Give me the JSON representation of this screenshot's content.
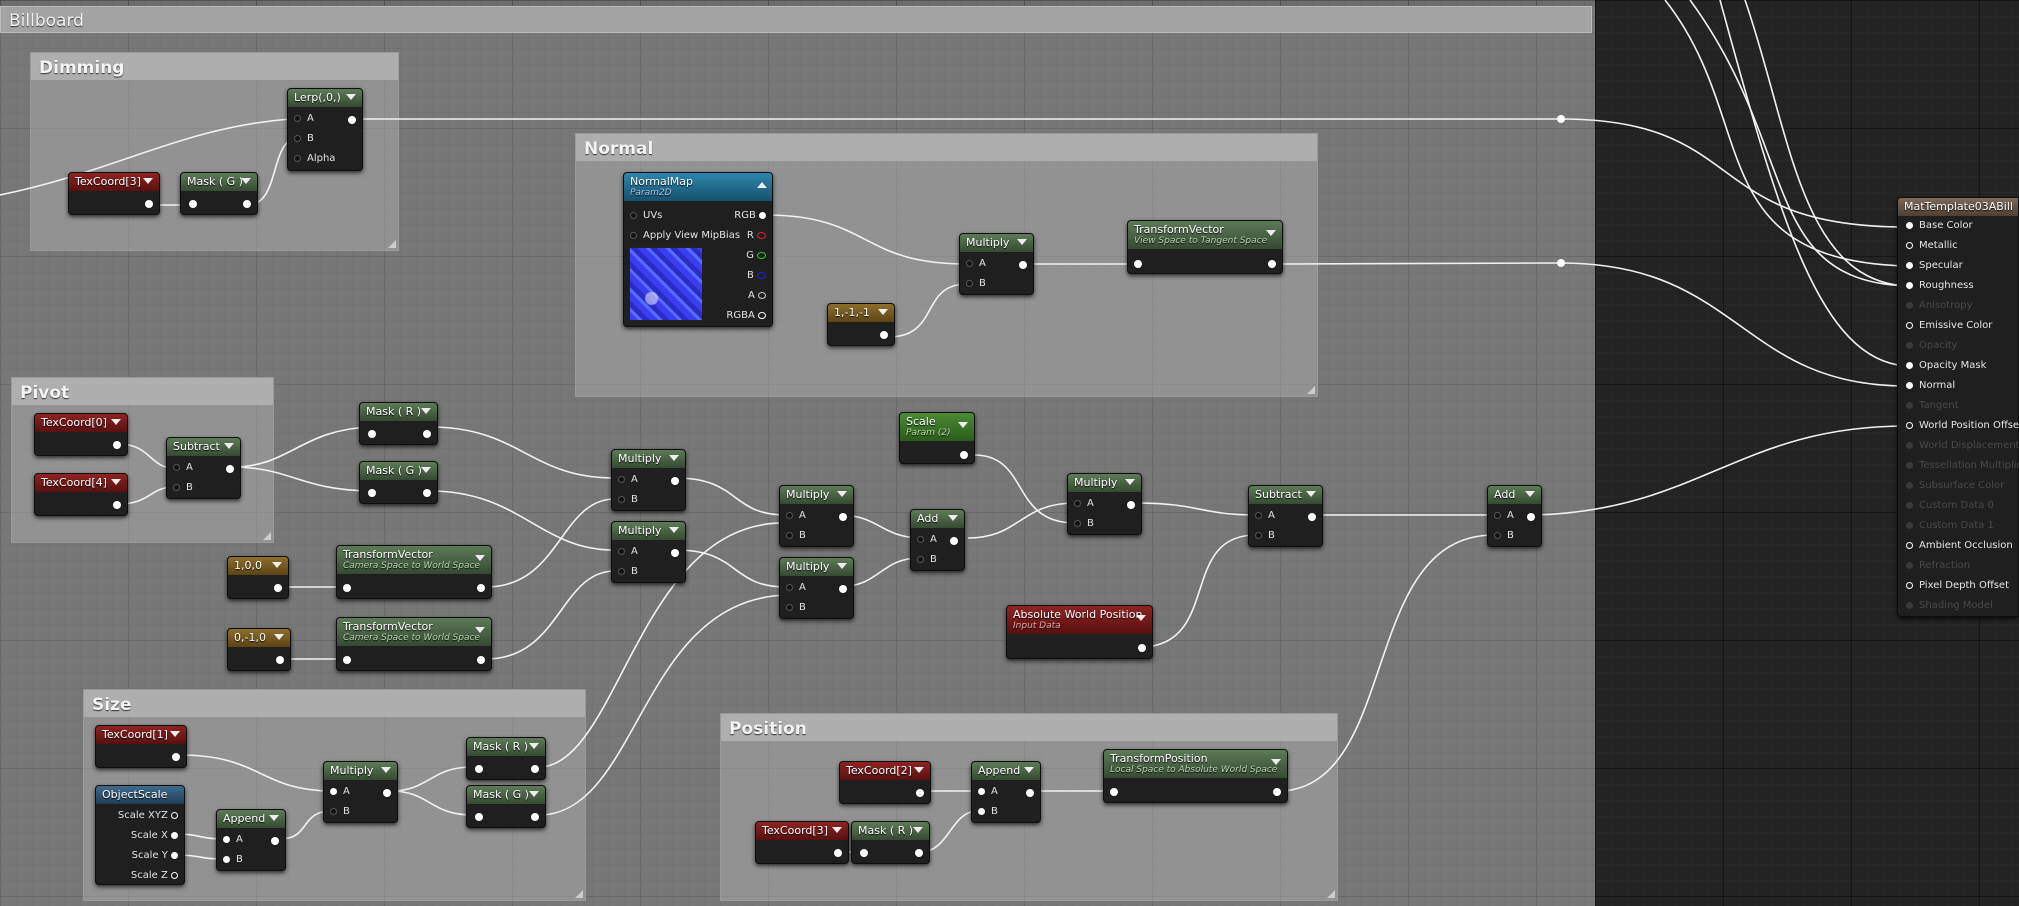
{
  "graph": {
    "title": "Billboard"
  },
  "comments": {
    "dimming": "Dimming",
    "normal": "Normal",
    "pivot": "Pivot",
    "size": "Size",
    "position": "Position"
  },
  "nodes": {
    "texcoord_dim": {
      "title": "TexCoord[3]"
    },
    "mask_g_dim": {
      "title": "Mask ( G )"
    },
    "lerp": {
      "title": "Lerp(,0,)",
      "pins": [
        "A",
        "B",
        "Alpha"
      ]
    },
    "normalmap": {
      "title": "NormalMap",
      "subtitle": "Param2D",
      "inputs": [
        "UVs",
        "Apply View MipBias"
      ],
      "outputs": [
        "RGB",
        "R",
        "G",
        "B",
        "A",
        "RGBA"
      ]
    },
    "const_neg": {
      "title": "1,-1,-1"
    },
    "multiply_normal": {
      "title": "Multiply",
      "pins": [
        "A",
        "B"
      ]
    },
    "transform_vector_tangent": {
      "title": "TransformVector",
      "subtitle": "View Space to Tangent Space"
    },
    "texcoord0": {
      "title": "TexCoord[0]"
    },
    "texcoord4": {
      "title": "TexCoord[4]"
    },
    "subtract_pivot": {
      "title": "Subtract",
      "pins": [
        "A",
        "B"
      ]
    },
    "mask_r_pivot": {
      "title": "Mask ( R )"
    },
    "mask_g_pivot": {
      "title": "Mask ( G )"
    },
    "const_x": {
      "title": "1,0,0"
    },
    "const_y": {
      "title": "0,-1,0"
    },
    "transform_vector_1": {
      "title": "TransformVector",
      "subtitle": "Camera Space to World Space"
    },
    "transform_vector_2": {
      "title": "TransformVector",
      "subtitle": "Camera Space to World Space"
    },
    "multiply_1": {
      "title": "Multiply",
      "pins": [
        "A",
        "B"
      ]
    },
    "multiply_2": {
      "title": "Multiply",
      "pins": [
        "A",
        "B"
      ]
    },
    "multiply_3": {
      "title": "Multiply",
      "pins": [
        "A",
        "B"
      ]
    },
    "multiply_4": {
      "title": "Multiply",
      "pins": [
        "A",
        "B"
      ]
    },
    "add_1": {
      "title": "Add",
      "pins": [
        "A",
        "B"
      ]
    },
    "scale": {
      "title": "Scale",
      "subtitle": "Param (2)"
    },
    "multiply_scale": {
      "title": "Multiply",
      "pins": [
        "A",
        "B"
      ]
    },
    "subtract_main": {
      "title": "Subtract",
      "pins": [
        "A",
        "B"
      ]
    },
    "add_main": {
      "title": "Add",
      "pins": [
        "A",
        "B"
      ]
    },
    "abs_world_pos": {
      "title": "Absolute World Position",
      "subtitle": "Input Data"
    },
    "texcoord1": {
      "title": "TexCoord[1]"
    },
    "object_scale": {
      "title": "ObjectScale",
      "outputs": [
        "Scale XYZ",
        "Scale X",
        "Scale Y",
        "Scale Z"
      ]
    },
    "append_size": {
      "title": "Append",
      "pins": [
        "A",
        "B"
      ]
    },
    "multiply_size": {
      "title": "Multiply",
      "pins": [
        "A",
        "B"
      ]
    },
    "mask_r_size": {
      "title": "Mask ( R )"
    },
    "mask_g_size": {
      "title": "Mask ( G )"
    },
    "texcoord2": {
      "title": "TexCoord[2]"
    },
    "texcoord3_pos": {
      "title": "TexCoord[3]"
    },
    "mask_r_pos": {
      "title": "Mask ( R )"
    },
    "append_pos": {
      "title": "Append",
      "pins": [
        "A",
        "B"
      ]
    },
    "transform_position": {
      "title": "TransformPosition",
      "subtitle": "Local Space to Absolute World Space"
    }
  },
  "material": {
    "title": "MatTemplate03ABill",
    "inputs": [
      {
        "label": "Base Color",
        "enabled": true
      },
      {
        "label": "Metallic",
        "enabled": true
      },
      {
        "label": "Specular",
        "enabled": true
      },
      {
        "label": "Roughness",
        "enabled": true
      },
      {
        "label": "Anisotropy",
        "enabled": false
      },
      {
        "label": "Emissive Color",
        "enabled": true
      },
      {
        "label": "Opacity",
        "enabled": false
      },
      {
        "label": "Opacity Mask",
        "enabled": true
      },
      {
        "label": "Normal",
        "enabled": true
      },
      {
        "label": "Tangent",
        "enabled": false
      },
      {
        "label": "World Position Offset",
        "enabled": true
      },
      {
        "label": "World Displacement",
        "enabled": false
      },
      {
        "label": "Tessellation Multiplier",
        "enabled": false
      },
      {
        "label": "Subsurface Color",
        "enabled": false
      },
      {
        "label": "Custom Data 0",
        "enabled": false
      },
      {
        "label": "Custom Data 1",
        "enabled": false
      },
      {
        "label": "Ambient Occlusion",
        "enabled": true
      },
      {
        "label": "Refraction",
        "enabled": false
      },
      {
        "label": "Pixel Depth Offset",
        "enabled": true
      },
      {
        "label": "Shading Model",
        "enabled": false
      }
    ]
  }
}
